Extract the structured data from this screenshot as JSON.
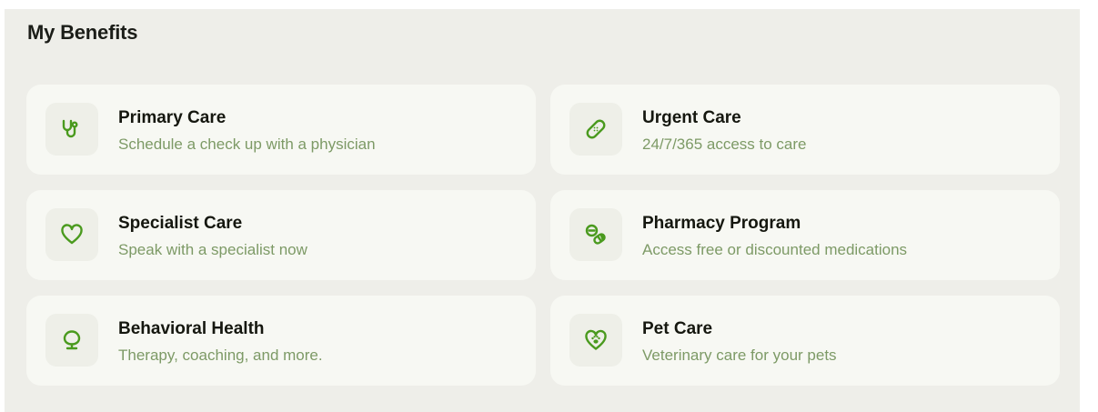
{
  "page": {
    "title": "My Benefits"
  },
  "colors": {
    "accent": "#4a9a1e",
    "subtitle": "#7d9a66",
    "card_bg": "#f7f8f3",
    "panel_bg": "#eeeee9"
  },
  "benefits": [
    {
      "title": "Primary Care",
      "subtitle": "Schedule a check up with a physician",
      "icon": "stethoscope-icon"
    },
    {
      "title": "Urgent Care",
      "subtitle": "24/7/365 access to care",
      "icon": "bandage-icon"
    },
    {
      "title": "Specialist Care",
      "subtitle": "Speak with a specialist now",
      "icon": "heart-icon"
    },
    {
      "title": "Pharmacy Program",
      "subtitle": "Access free or discounted medications",
      "icon": "pills-icon"
    },
    {
      "title": "Behavioral Health",
      "subtitle": "Therapy, coaching, and more.",
      "icon": "brain-head-icon"
    },
    {
      "title": "Pet Care",
      "subtitle": "Veterinary care for your pets",
      "icon": "paw-heart-icon"
    }
  ]
}
